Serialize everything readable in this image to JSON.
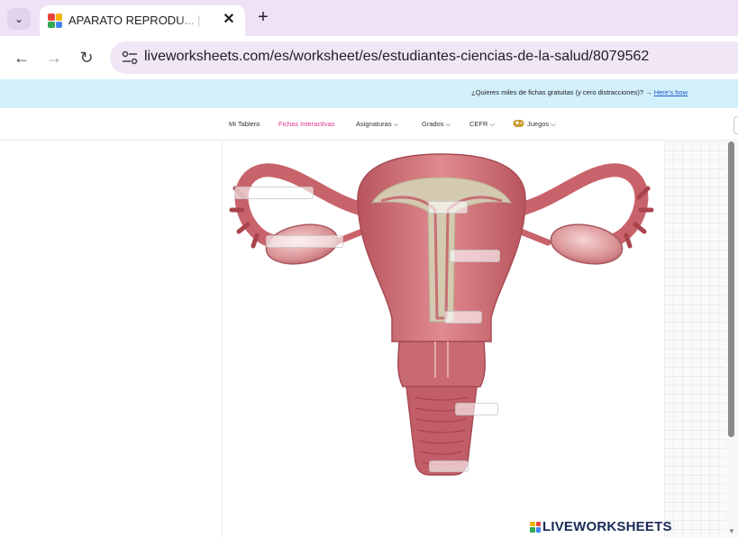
{
  "browser": {
    "tab_title": "APARATO REPRODU... | Free Int",
    "tab_close": "✕",
    "new_tab": "+",
    "tab_menu": "⌄",
    "back": "←",
    "forward": "→",
    "reload": "↻",
    "url": "liveworksheets.com/es/worksheet/es/estudiantes-ciencias-de-la-salud/8079562"
  },
  "banner": {
    "text": "¿Quieres miles de fichas gratuitas (y cero distracciones)? → ",
    "link": "Here's how"
  },
  "sitenav": {
    "items": [
      {
        "label": "Mi Tablero",
        "active": false
      },
      {
        "label": "Fichas Interactivas",
        "active": true
      },
      {
        "label": "Asignaturas ⌵",
        "active": false
      },
      {
        "label": "Grados ⌵",
        "active": false
      },
      {
        "label": "CEFR ⌵",
        "active": false
      },
      {
        "label": "Juegos ⌵",
        "active": false
      }
    ],
    "search_glyph": "Q"
  },
  "worksheet": {
    "answer_boxes": [
      "",
      "",
      "",
      "",
      "",
      "",
      "",
      ""
    ]
  },
  "logo": {
    "text": "LIVEWORKSHEETS"
  },
  "colors": {
    "tabbar_bg": "#efe2f6",
    "banner_bg": "#d2f0fb",
    "nav_active": "#e0338b",
    "logo_text": "#1b2b57",
    "tissue": "#d8777e",
    "lining": "#cfc8b0"
  }
}
